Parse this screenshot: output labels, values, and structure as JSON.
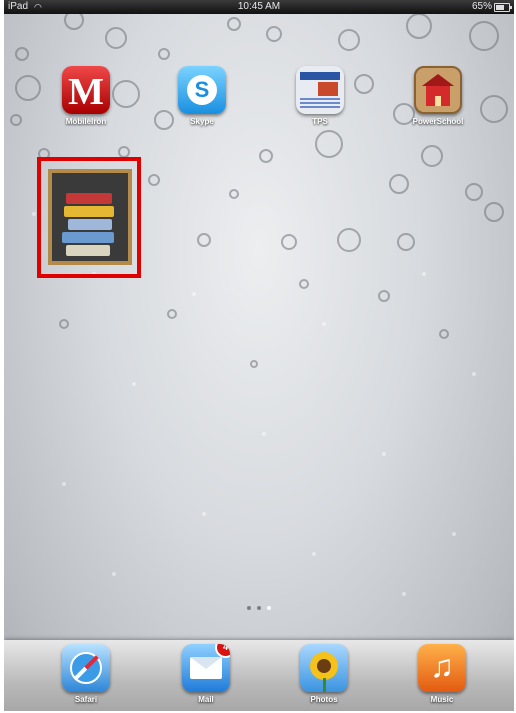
{
  "status_bar": {
    "carrier": "iPad",
    "time": "10:45 AM",
    "battery": "65%"
  },
  "home_apps": [
    {
      "label": "MobileIron",
      "icon": "mobileiron-icon",
      "glyph": "M"
    },
    {
      "label": "Skype",
      "icon": "skype-icon",
      "glyph": "S"
    },
    {
      "label": "TPS",
      "icon": "tps-icon"
    },
    {
      "label": "PowerSchool",
      "icon": "powerschool-icon"
    }
  ],
  "highlighted_app": {
    "label": "",
    "icon": "books-icon",
    "highlight_color": "#e00000"
  },
  "page_indicator": {
    "pages": 3,
    "current": 3
  },
  "dock": [
    {
      "label": "Safari",
      "icon": "safari-icon"
    },
    {
      "label": "Mail",
      "icon": "mail-icon",
      "badge": "4"
    },
    {
      "label": "Photos",
      "icon": "photos-icon"
    },
    {
      "label": "Music",
      "icon": "music-icon",
      "glyph": "♫"
    }
  ]
}
